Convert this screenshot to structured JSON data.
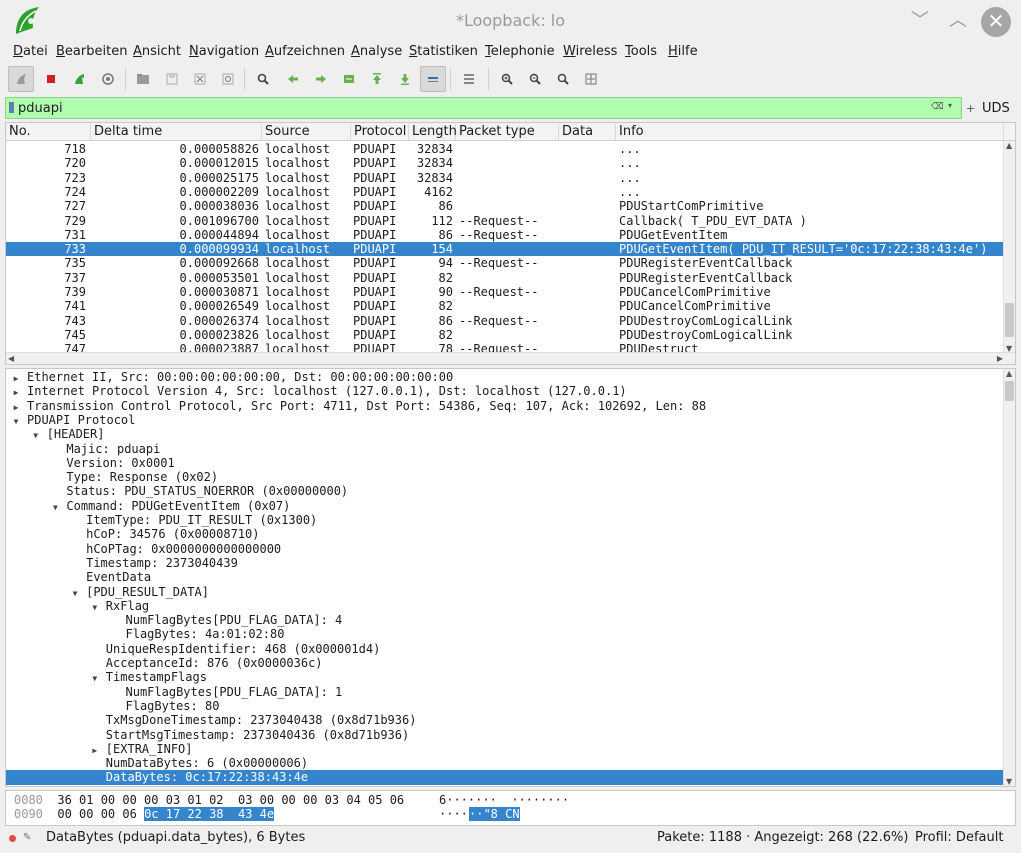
{
  "window": {
    "title": "*Loopback: lo",
    "minimize": "﹀",
    "maximize": "︿",
    "close": "✕"
  },
  "menu": [
    "Datei",
    "Bearbeiten",
    "Ansicht",
    "Navigation",
    "Aufzeichnen",
    "Analyse",
    "Statistiken",
    "Telephonie",
    "Wireless",
    "Tools",
    "Hilfe"
  ],
  "toolbar_icons": [
    "shark-fin-start-icon",
    "stop-icon",
    "restart-icon",
    "capture-options-icon",
    "open-file-icon",
    "save-file-icon",
    "close-file-icon",
    "reload-icon",
    "find-packet-icon",
    "go-back-icon",
    "go-forward-icon",
    "go-to-packet-icon",
    "first-packet-icon",
    "last-packet-icon",
    "autoscroll-icon",
    "colorize-icon",
    "zoom-in-icon",
    "zoom-out-icon",
    "normal-size-icon",
    "resize-columns-icon"
  ],
  "filter": {
    "value": "pduapi",
    "clear": "⌫",
    "dropdown": "▾",
    "plus": "+",
    "button_label": "UDS"
  },
  "columns": [
    "No.",
    "Delta time",
    "Source",
    "Protocol",
    "Length",
    "Packet type",
    "Data",
    "Info"
  ],
  "packets": [
    {
      "no": "718",
      "delta": "0.000058826",
      "src": "localhost",
      "proto": "PDUAPI",
      "len": "32834",
      "type": "",
      "data": "",
      "info": "..."
    },
    {
      "no": "720",
      "delta": "0.000012015",
      "src": "localhost",
      "proto": "PDUAPI",
      "len": "32834",
      "type": "",
      "data": "",
      "info": "..."
    },
    {
      "no": "723",
      "delta": "0.000025175",
      "src": "localhost",
      "proto": "PDUAPI",
      "len": "32834",
      "type": "",
      "data": "",
      "info": "..."
    },
    {
      "no": "724",
      "delta": "0.000002209",
      "src": "localhost",
      "proto": "PDUAPI",
      "len": "4162",
      "type": "",
      "data": "",
      "info": "..."
    },
    {
      "no": "727",
      "delta": "0.000038036",
      "src": "localhost",
      "proto": "PDUAPI",
      "len": "86",
      "type": "",
      "data": "",
      "info": "PDUStartComPrimitive"
    },
    {
      "no": "729",
      "delta": "0.001096700",
      "src": "localhost",
      "proto": "PDUAPI",
      "len": "112",
      "type": "--Request--",
      "data": "",
      "info": "Callback( T_PDU_EVT_DATA )"
    },
    {
      "no": "731",
      "delta": "0.000044894",
      "src": "localhost",
      "proto": "PDUAPI",
      "len": "86",
      "type": "--Request--",
      "data": "",
      "info": "PDUGetEventItem"
    },
    {
      "no": "733",
      "delta": "0.000099934",
      "src": "localhost",
      "proto": "PDUAPI",
      "len": "154",
      "type": "",
      "data": "",
      "info": "PDUGetEventItem( PDU_IT_RESULT='0c:17:22:38:43:4e')"
    },
    {
      "no": "735",
      "delta": "0.000092668",
      "src": "localhost",
      "proto": "PDUAPI",
      "len": "94",
      "type": "--Request--",
      "data": "",
      "info": "PDURegisterEventCallback"
    },
    {
      "no": "737",
      "delta": "0.000053501",
      "src": "localhost",
      "proto": "PDUAPI",
      "len": "82",
      "type": "",
      "data": "",
      "info": "PDURegisterEventCallback"
    },
    {
      "no": "739",
      "delta": "0.000030871",
      "src": "localhost",
      "proto": "PDUAPI",
      "len": "90",
      "type": "--Request--",
      "data": "",
      "info": "PDUCancelComPrimitive"
    },
    {
      "no": "741",
      "delta": "0.000026549",
      "src": "localhost",
      "proto": "PDUAPI",
      "len": "82",
      "type": "",
      "data": "",
      "info": "PDUCancelComPrimitive"
    },
    {
      "no": "743",
      "delta": "0.000026374",
      "src": "localhost",
      "proto": "PDUAPI",
      "len": "86",
      "type": "--Request--",
      "data": "",
      "info": "PDUDestroyComLogicalLink"
    },
    {
      "no": "745",
      "delta": "0.000023826",
      "src": "localhost",
      "proto": "PDUAPI",
      "len": "82",
      "type": "",
      "data": "",
      "info": "PDUDestroyComLogicalLink"
    },
    {
      "no": "747",
      "delta": "0.000023887",
      "src": "localhost",
      "proto": "PDUAPI",
      "len": "78",
      "type": "--Request--",
      "data": "",
      "info": "PDUDestruct"
    }
  ],
  "selected_packet_index": 7,
  "details": [
    {
      "level": 0,
      "twisty": "▶",
      "text": "Ethernet II, Src: 00:00:00:00:00:00, Dst: 00:00:00:00:00:00"
    },
    {
      "level": 0,
      "twisty": "▶",
      "text": "Internet Protocol Version 4, Src: localhost (127.0.0.1), Dst: localhost (127.0.0.1)"
    },
    {
      "level": 0,
      "twisty": "▶",
      "text": "Transmission Control Protocol, Src Port: 4711, Dst Port: 54386, Seq: 107, Ack: 102692, Len: 88"
    },
    {
      "level": 0,
      "twisty": "▼",
      "text": "PDUAPI Protocol"
    },
    {
      "level": 1,
      "twisty": "▼",
      "text": "[HEADER]"
    },
    {
      "level": 2,
      "twisty": "",
      "text": "Majic: pduapi"
    },
    {
      "level": 2,
      "twisty": "",
      "text": "Version: 0x0001"
    },
    {
      "level": 2,
      "twisty": "",
      "text": "Type: Response (0x02)"
    },
    {
      "level": 2,
      "twisty": "",
      "text": "Status: PDU_STATUS_NOERROR (0x00000000)"
    },
    {
      "level": 2,
      "twisty": "▼",
      "text": "Command: PDUGetEventItem (0x07)"
    },
    {
      "level": 3,
      "twisty": "",
      "text": "ItemType: PDU_IT_RESULT (0x1300)"
    },
    {
      "level": 3,
      "twisty": "",
      "text": "hCoP: 34576 (0x00008710)"
    },
    {
      "level": 3,
      "twisty": "",
      "text": "hCoPTag: 0x0000000000000000"
    },
    {
      "level": 3,
      "twisty": "",
      "text": "Timestamp: 2373040439"
    },
    {
      "level": 3,
      "twisty": "",
      "text": "EventData"
    },
    {
      "level": 3,
      "twisty": "▼",
      "text": "[PDU_RESULT_DATA]"
    },
    {
      "level": 4,
      "twisty": "▼",
      "text": "RxFlag"
    },
    {
      "level": 5,
      "twisty": "",
      "text": "NumFlagBytes[PDU_FLAG_DATA]: 4"
    },
    {
      "level": 5,
      "twisty": "",
      "text": "FlagBytes: 4a:01:02:80"
    },
    {
      "level": 4,
      "twisty": "",
      "text": "UniqueRespIdentifier: 468 (0x000001d4)"
    },
    {
      "level": 4,
      "twisty": "",
      "text": "AcceptanceId: 876 (0x0000036c)"
    },
    {
      "level": 4,
      "twisty": "▼",
      "text": "TimestampFlags"
    },
    {
      "level": 5,
      "twisty": "",
      "text": "NumFlagBytes[PDU_FLAG_DATA]: 1"
    },
    {
      "level": 5,
      "twisty": "",
      "text": "FlagBytes: 80"
    },
    {
      "level": 4,
      "twisty": "",
      "text": "TxMsgDoneTimestamp: 2373040438 (0x8d71b936)"
    },
    {
      "level": 4,
      "twisty": "",
      "text": "StartMsgTimestamp: 2373040436 (0x8d71b936)"
    },
    {
      "level": 4,
      "twisty": "▶",
      "text": "[EXTRA_INFO]"
    },
    {
      "level": 4,
      "twisty": "",
      "text": "NumDataBytes: 6 (0x00000006)"
    },
    {
      "level": 4,
      "twisty": "",
      "text": "DataBytes: 0c:17:22:38:43:4e"
    }
  ],
  "selected_detail_index": 28,
  "hex": [
    {
      "offset": "0080",
      "bytes": "36 01 00 00 00 03 01 02  03 00 00 00 03 04 05 06",
      "sel_bytes": "",
      "ascii": "6·······  ········",
      "sel_ascii": ""
    },
    {
      "offset": "0090",
      "bytes": "00 00 00 06 ",
      "sel_bytes": "0c 17 22 38  43 4e",
      "ascii": "····",
      "sel_ascii": "··\"8 CN"
    }
  ],
  "status": {
    "text": "DataBytes (pduapi.data_bytes), 6 Bytes",
    "packets": "Pakete: 1188 · Angezeigt: 268 (22.6%)",
    "profile": "Profil: Default"
  }
}
